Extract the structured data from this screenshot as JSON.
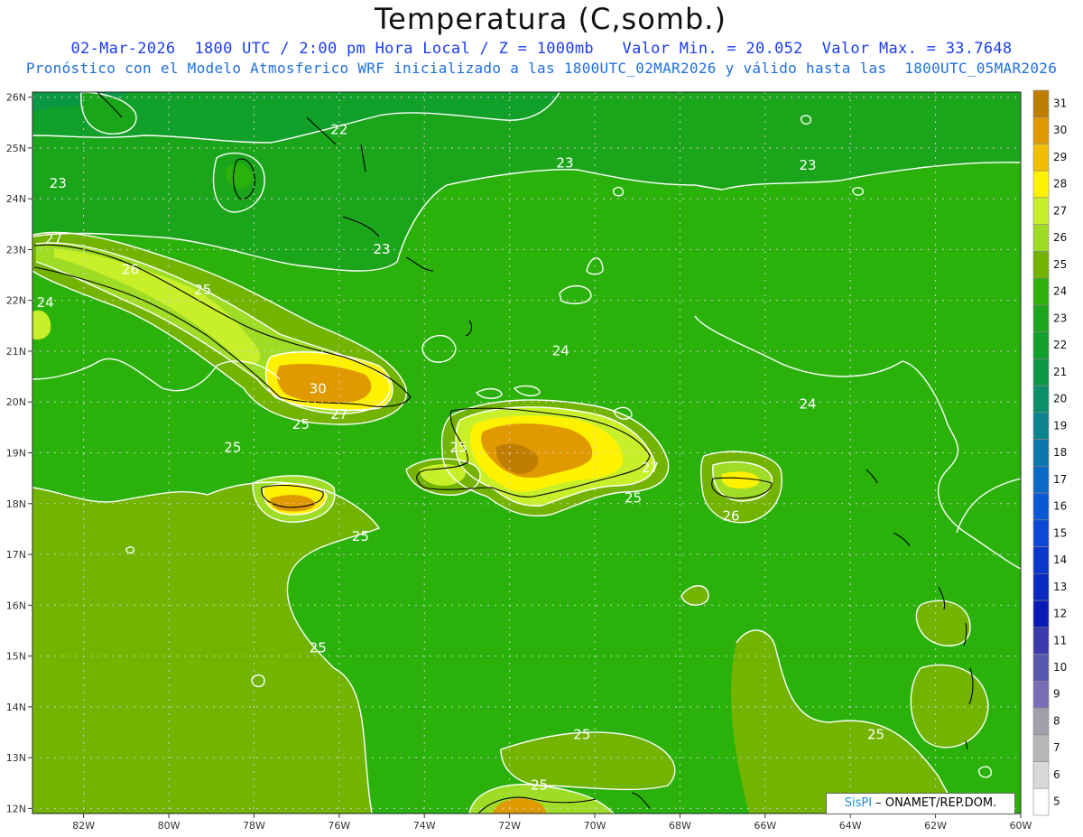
{
  "title": "Temperatura (C,somb.)",
  "subtitle_line1": "02-Mar-2026  1800 UTC / 2:00 pm Hora Local / Z = 1000mb   Valor Min. = 20.052  Valor Max. = 33.7648",
  "subtitle_line2": "Pronóstico con el Modelo Atmosferico WRF inicializado a las 1800UTC_02MAR2026 y válido hasta las  1800UTC_05MAR2026",
  "map": {
    "lon_range": [
      -83.2,
      -60.0
    ],
    "lat_range": [
      11.9,
      26.1
    ],
    "lon_ticks": [
      "82W",
      "80W",
      "78W",
      "76W",
      "74W",
      "72W",
      "70W",
      "68W",
      "66W",
      "64W",
      "62W",
      "60W"
    ],
    "lat_ticks": [
      "12N",
      "13N",
      "14N",
      "15N",
      "16N",
      "17N",
      "18N",
      "19N",
      "20N",
      "21N",
      "22N",
      "23N",
      "24N",
      "25N",
      "26N"
    ],
    "grid": true
  },
  "contour_labels": [
    {
      "text": "22",
      "lon": -76.0,
      "lat": 25.35
    },
    {
      "text": "23",
      "lon": -82.6,
      "lat": 24.3
    },
    {
      "text": "23",
      "lon": -70.7,
      "lat": 24.7
    },
    {
      "text": "23",
      "lon": -65.0,
      "lat": 24.65
    },
    {
      "text": "23",
      "lon": -75.0,
      "lat": 23.0
    },
    {
      "text": "27",
      "lon": -82.7,
      "lat": 23.2
    },
    {
      "text": "26",
      "lon": -80.9,
      "lat": 22.6
    },
    {
      "text": "25",
      "lon": -79.2,
      "lat": 22.2
    },
    {
      "text": "24",
      "lon": -82.9,
      "lat": 21.95
    },
    {
      "text": "24",
      "lon": -70.8,
      "lat": 21.0
    },
    {
      "text": "24",
      "lon": -65.0,
      "lat": 19.95
    },
    {
      "text": "30",
      "lon": -76.5,
      "lat": 20.25
    },
    {
      "text": "25",
      "lon": -76.9,
      "lat": 19.55
    },
    {
      "text": "27",
      "lon": -76.0,
      "lat": 19.75
    },
    {
      "text": "25",
      "lon": -78.5,
      "lat": 19.1
    },
    {
      "text": "25",
      "lon": -73.2,
      "lat": 19.1
    },
    {
      "text": "27",
      "lon": -68.7,
      "lat": 18.7
    },
    {
      "text": "25",
      "lon": -69.1,
      "lat": 18.1
    },
    {
      "text": "26",
      "lon": -66.8,
      "lat": 17.75
    },
    {
      "text": "25",
      "lon": -75.5,
      "lat": 17.35
    },
    {
      "text": "25",
      "lon": -76.5,
      "lat": 15.15
    },
    {
      "text": "25",
      "lon": -70.3,
      "lat": 13.45
    },
    {
      "text": "25",
      "lon": -63.4,
      "lat": 13.45
    },
    {
      "text": "25",
      "lon": -71.3,
      "lat": 12.45
    }
  ],
  "legend": {
    "levels": [
      "31",
      "30",
      "29",
      "28",
      "27",
      "26",
      "25",
      "24",
      "23",
      "22",
      "21",
      "20",
      "19",
      "18",
      "17",
      "16",
      "15",
      "14",
      "13",
      "12",
      "11",
      "10",
      "9",
      "8",
      "7",
      "6",
      "5"
    ],
    "colors": [
      "#c07e00",
      "#e09a00",
      "#f2be00",
      "#fff200",
      "#c8f02a",
      "#9edc25",
      "#72b400",
      "#2ab20a",
      "#1ba51a",
      "#11a02a",
      "#0b9845",
      "#0a8f68",
      "#0a8590",
      "#0a78ae",
      "#0a68c6",
      "#0a58d6",
      "#0a48d6",
      "#0a38ce",
      "#0a28c2",
      "#0a1ab6",
      "#3a3aac",
      "#5858b0",
      "#7a6cb6",
      "#a09fab",
      "#b6b6b6",
      "#d9d9d9",
      "#ffffff"
    ]
  },
  "credit": {
    "brand": "SisPI",
    "text": " – ONAMET/REP.DOM."
  }
}
